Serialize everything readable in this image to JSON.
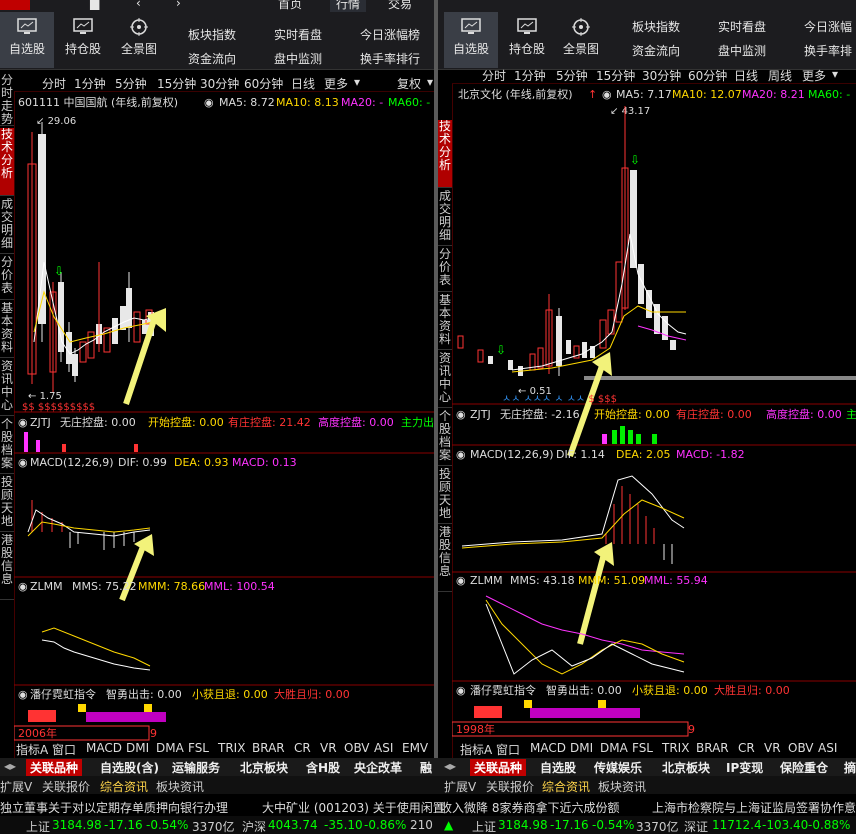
{
  "colors": {
    "up": "#ff3333",
    "down": "#00ff00",
    "accent": "#ffd800",
    "magenta": "#ff33ff",
    "panel_bg": "#000000",
    "active_tab": "#c00000"
  },
  "left": {
    "nav_top": {
      "item1": "首页",
      "item2": "行情",
      "item3": "交易"
    },
    "buttons": [
      {
        "label": "自选股",
        "icon": "monitor-icon"
      },
      {
        "label": "持仓股",
        "icon": "monitor-icon"
      },
      {
        "label": "全景图",
        "icon": "crosshair-icon"
      }
    ],
    "menu": [
      [
        "板块指数",
        "资金流向"
      ],
      [
        "实时看盘",
        "盘中监测"
      ],
      [
        "今日涨幅榜",
        "换手率排行"
      ]
    ],
    "periods": [
      "分时",
      "1分钟",
      "5分钟",
      "15分钟",
      "30分钟",
      "60分钟",
      "日线",
      "更多"
    ],
    "fq": "复权",
    "vtabs": [
      "分时走势",
      "技术分析",
      "成交明细",
      "分价表",
      "基本资料",
      "资讯中心",
      "个股档案",
      "投顾天地",
      "港股信息"
    ],
    "stock": "601111 中国国航 (年线,前复权)",
    "ma": {
      "ma5": "MA5: 8.72",
      "ma10": "MA10: 8.13",
      "ma20": "MA20: -",
      "ma60": "MA60: -"
    },
    "high": "29.06",
    "low": "1.75",
    "zjtj": {
      "name": "ZJTJ",
      "no": "无庄控盘: 0.00",
      "start": "开始控盘: 0.00",
      "has": "有庄控盘: 21.42",
      "high": "高度控盘: 0.00",
      "main": "主力出"
    },
    "macd": {
      "name": "MACD(12,26,9)",
      "dif": "DIF: 0.99",
      "dea": "DEA: 0.93",
      "macd": "MACD: 0.13"
    },
    "zlmm": {
      "name": "ZLMM",
      "mms": "MMS: 75.22",
      "mmm": "MMM: 78.66",
      "mml": "MML: 100.54"
    },
    "pan": {
      "name": "潘仔霓虹指令",
      "zy": "智勇出击: 0.00",
      "xh": "小获且退: 0.00",
      "ds": "大胜且归: 0.00"
    },
    "date": "2006年",
    "date2": "9",
    "indicators": [
      "指标A",
      "窗口",
      "MACD",
      "DMI",
      "DMA",
      "FSL",
      "TRIX",
      "BRAR",
      "CR",
      "VR",
      "OBV",
      "ASI",
      "EMV"
    ]
  },
  "right": {
    "buttons": [
      {
        "label": "自选股",
        "icon": "monitor-icon"
      },
      {
        "label": "持仓股",
        "icon": "monitor-icon"
      },
      {
        "label": "全景图",
        "icon": "crosshair-icon"
      }
    ],
    "menu": [
      [
        "板块指数",
        "资金流向"
      ],
      [
        "实时看盘",
        "盘中监测"
      ],
      [
        "今日涨幅",
        "换手率排"
      ]
    ],
    "periods": [
      "分时",
      "1分钟",
      "5分钟",
      "15分钟",
      "30分钟",
      "60分钟",
      "日线",
      "周线",
      "更多"
    ],
    "vtabs": [
      "技术分析",
      "成交明细",
      "分价表",
      "基本资料",
      "资讯中心",
      "个股档案",
      "投顾天地",
      "港股信息"
    ],
    "stock": "北京文化 (年线,前复权)",
    "ma": {
      "ma5": "MA5: 7.17",
      "ma10": "MA10: 12.07",
      "ma20": "MA20: 8.21",
      "ma60": "MA60: -"
    },
    "high": "43.17",
    "low": "0.51",
    "zjtj": {
      "name": "ZJTJ",
      "no": "无庄控盘: -2.16",
      "start": "开始控盘: 0.00",
      "has": "有庄控盘: 0.00",
      "high": "高度控盘: 0.00",
      "main": "主"
    },
    "macd": {
      "name": "MACD(12,26,9)",
      "dif": "DIF: 1.14",
      "dea": "DEA: 2.05",
      "macd": "MACD: -1.82"
    },
    "zlmm": {
      "name": "ZLMM",
      "mms": "MMS: 43.18",
      "mmm": "MMM: 51.09",
      "mml": "MML: 55.94"
    },
    "pan": {
      "name": "潘仔霓虹指令",
      "zy": "智勇出击: 0.00",
      "xh": "小获且退: 0.00",
      "ds": "大胜且归: 0.00"
    },
    "date": "1998年",
    "date2": "9",
    "indicators": [
      "指标A",
      "窗口",
      "MACD",
      "DMI",
      "DMA",
      "FSL",
      "TRIX",
      "BRAR",
      "CR",
      "VR",
      "OBV",
      "ASI"
    ]
  },
  "bottom_tabs": [
    {
      "label": "关联品种",
      "active": true
    },
    {
      "label": "自选股(含)"
    },
    {
      "label": "运输服务"
    },
    {
      "label": "北京板块"
    },
    {
      "label": "含H股"
    },
    {
      "label": "央企改革"
    },
    {
      "label": "融"
    },
    {
      "label": "关联品种",
      "active": true
    },
    {
      "label": "自选股"
    },
    {
      "label": "传媒娱乐"
    },
    {
      "label": "北京板块"
    },
    {
      "label": "IP变现"
    },
    {
      "label": "保险重仓"
    },
    {
      "label": "摘"
    }
  ],
  "info_tabs": [
    "扩展V",
    "关联报价",
    "综合资讯",
    "板块资讯",
    "扩展V",
    "关联报价",
    "综合资讯",
    "板块资讯"
  ],
  "news": [
    "独立董事关于对以定期存单质押向银行办理",
    "大中矿业 (001203) 关于使用闲置",
    "收入微降 8家券商拿下近六成份额",
    "上海市检察院与上海证监局签署协作意"
  ],
  "status_left": {
    "label": "上证",
    "value": "3184.98",
    "chg": "-17.16",
    "pct": "-0.54%",
    "vol": "3370亿",
    "label2": "沪深",
    "value2": "4043.74",
    "chg2": "-35.10",
    "pct2": "-0.86%",
    "tail": "210"
  },
  "status_right": {
    "label": "上证",
    "value": "3184.98",
    "chg": "-17.16",
    "pct": "-0.54%",
    "vol": "3370亿",
    "label2": "深证",
    "value2": "11712.4",
    "chg2": "-103.40",
    "pct2": "-0.88%"
  }
}
